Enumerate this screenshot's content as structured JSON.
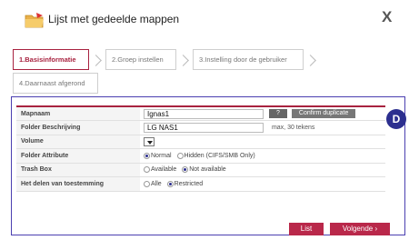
{
  "dialog": {
    "title": "Lijst met gedeelde mappen",
    "close_label": "X"
  },
  "steps": [
    {
      "label": "1.Basisinformatie"
    },
    {
      "label": "2.Groep instellen"
    },
    {
      "label": "3.Instelling door de gebruiker"
    },
    {
      "label": "4.Daarnaast afgerond"
    }
  ],
  "form": {
    "mapnaam": {
      "label": "Mapnaam",
      "value": "Ignas1",
      "help_label": "?",
      "confirm_label": "Confirm duplicate"
    },
    "beschrijving": {
      "label": "Folder Beschrijving",
      "value": "LG NAS1",
      "hint": "max, 30 tekens"
    },
    "volume": {
      "label": "Volume"
    },
    "attribute": {
      "label": "Folder Attribute",
      "options": [
        "Normal",
        "Hidden (CIFS/SMB Only)"
      ],
      "selected": "Normal"
    },
    "trash": {
      "label": "Trash Box",
      "options": [
        "Available",
        "Not available"
      ],
      "selected": "Not available"
    },
    "delen": {
      "label": "Het delen van toestemming",
      "options": [
        "Alle",
        "Restricted"
      ],
      "selected": "Restricted"
    }
  },
  "annotation_badge": "D",
  "buttons": {
    "list": "List",
    "next": "Volgende ›"
  },
  "colors": {
    "accent": "#a8223f",
    "panel_border": "#4a3fb0",
    "badge": "#2c2f8f"
  }
}
